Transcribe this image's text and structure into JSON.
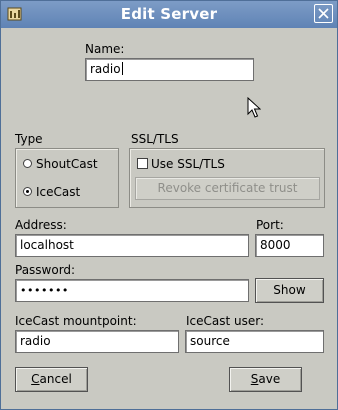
{
  "window": {
    "title": "Edit Server"
  },
  "name": {
    "label": "Name:",
    "value": "radio"
  },
  "type": {
    "label": "Type",
    "options": [
      {
        "label": "ShoutCast",
        "selected": false
      },
      {
        "label": "IceCast",
        "selected": true
      }
    ]
  },
  "ssl": {
    "label": "SSL/TLS",
    "use_ssl_label": "Use SSL/TLS",
    "use_ssl_checked": false,
    "revoke_label": "Revoke certificate trust"
  },
  "address": {
    "label": "Address:",
    "value": "localhost"
  },
  "port": {
    "label": "Port:",
    "value": "8000"
  },
  "password": {
    "label": "Password:",
    "value": "•••••••",
    "show_label": "Show"
  },
  "mountpoint": {
    "label": "IceCast mountpoint:",
    "value": "radio"
  },
  "user": {
    "label": "IceCast user:",
    "value": "source"
  },
  "buttons": {
    "cancel_mnemonic": "C",
    "cancel_rest": "ancel",
    "save_mnemonic": "S",
    "save_rest": "ave"
  },
  "icons": {
    "app": "app-icon",
    "close": "close-icon",
    "pointer": "mouse-pointer-icon"
  }
}
